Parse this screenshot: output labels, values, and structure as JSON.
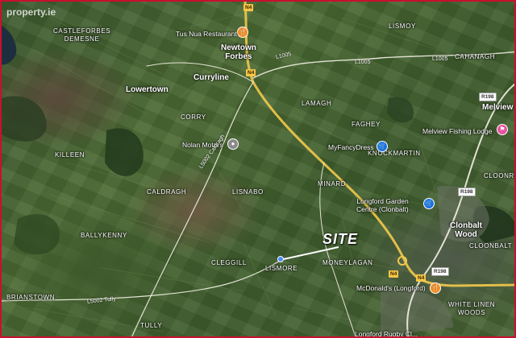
{
  "watermark": "property.ie",
  "site_label": "SITE",
  "colors": {
    "national_road": "#f2c94c",
    "regional_road": "#f4f1e6",
    "restaurant_pin": "#f58b1f",
    "shop_pin": "#1a73e8",
    "attraction_pin": "#8a8a8a",
    "lodge_pin": "#e754a0",
    "frame": "#c8102e"
  },
  "areas": [
    {
      "id": "castleforbes",
      "text": "CASTLEFORBES\nDEMESNE"
    },
    {
      "id": "lismoy",
      "text": "LISMOY"
    },
    {
      "id": "corry",
      "text": "CORRY"
    },
    {
      "id": "lamagh",
      "text": "LAMAGH"
    },
    {
      "id": "faghey",
      "text": "FAGHEY"
    },
    {
      "id": "cahanagh",
      "text": "CAHANAGH"
    },
    {
      "id": "killeen",
      "text": "KILLEEN"
    },
    {
      "id": "knockmartin",
      "text": "KNOCKMARTIN"
    },
    {
      "id": "caldragh",
      "text": "CALDRAGH"
    },
    {
      "id": "lisnabo",
      "text": "LISNABO"
    },
    {
      "id": "minard",
      "text": "MINARD"
    },
    {
      "id": "cloonrala",
      "text": "CLOONRALA"
    },
    {
      "id": "ballykenny",
      "text": "BALLYKENNY"
    },
    {
      "id": "cleggill",
      "text": "CLEGGILL"
    },
    {
      "id": "lismore",
      "text": "LISMORE"
    },
    {
      "id": "moneylagan",
      "text": "MONEYLAGAN"
    },
    {
      "id": "cloonbalt",
      "text": "CLOONBALT"
    },
    {
      "id": "brianstown",
      "text": "BRIANSTOWN"
    },
    {
      "id": "white_linen",
      "text": "WHITE LINEN\nWOODS"
    },
    {
      "id": "tully",
      "text": "TULLY"
    }
  ],
  "towns": [
    {
      "id": "newtown",
      "text": "Newtown\nForbes"
    },
    {
      "id": "lowertown",
      "text": "Lowertown"
    },
    {
      "id": "curryline",
      "text": "Curryline"
    },
    {
      "id": "melview",
      "text": "Melview"
    },
    {
      "id": "clonbalt",
      "text": "Clonbalt\nWood"
    }
  ],
  "pois": [
    {
      "id": "tus_nua",
      "text": "Tus Nua Restaurant",
      "icon": "restaurant-icon"
    },
    {
      "id": "nolan",
      "text": "Nolan Motors",
      "icon": "place-icon"
    },
    {
      "id": "fancy",
      "text": "MyFancyDress",
      "icon": "shopping-icon"
    },
    {
      "id": "melview_lodge",
      "text": "Melview Fishing Lodge",
      "icon": "lodging-icon"
    },
    {
      "id": "garden",
      "text": "Longford Garden\nCentre (Clonbalt)",
      "icon": "shopping-icon"
    },
    {
      "id": "mcd",
      "text": "McDonald's (Longford)",
      "icon": "restaurant-icon"
    },
    {
      "id": "rugby",
      "text": "Longford Rugby Cl...",
      "icon": "place-icon"
    }
  ],
  "roads": {
    "n4_badges": [
      "N4",
      "N4",
      "N4",
      "N4"
    ],
    "r198_badges": [
      "R198",
      "R198",
      "R198"
    ],
    "l1005_texts": [
      "L1005",
      "L1005",
      "L1005"
    ],
    "l5002_caldragh": "L5002 Caldragh",
    "l5002_tully": "L5002 Tully"
  }
}
